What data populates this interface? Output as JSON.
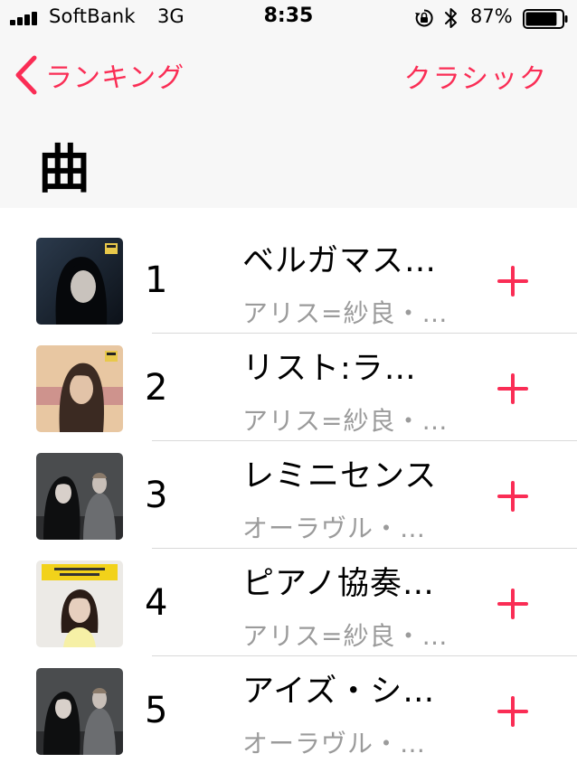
{
  "status_bar": {
    "carrier": "SoftBank",
    "network": "3G",
    "time": "8:35",
    "battery_percent": "87%",
    "battery_level": 0.87,
    "icons": [
      "signal-icon",
      "orientation-lock-icon",
      "bluetooth-icon",
      "battery-icon"
    ]
  },
  "nav": {
    "back_label": "ランキング",
    "genre_label": "クラシック",
    "title": "曲"
  },
  "colors": {
    "accent": "#fa2d55",
    "secondary_text": "#9b9b9b",
    "header_bg": "#f7f7f7"
  },
  "songs": [
    {
      "rank": "1",
      "title": "ベルガマス…",
      "artist": "アリス=紗良・…",
      "artwork": "nightfall-album-art"
    },
    {
      "rank": "2",
      "title": "リスト:ラ…",
      "artist": "アリス=紗良・…",
      "artwork": "memories-album-art"
    },
    {
      "rank": "3",
      "title": "レミニセンス",
      "artist": "オーラヴル・…",
      "artwork": "chopin-project-album-art"
    },
    {
      "rank": "4",
      "title": "ピアノ協奏…",
      "artist": "アリス=紗良・…",
      "artwork": "wonderland-album-art"
    },
    {
      "rank": "5",
      "title": "アイズ・シ…",
      "artist": "オーラヴル・…",
      "artwork": "chopin-project-album-art"
    }
  ]
}
